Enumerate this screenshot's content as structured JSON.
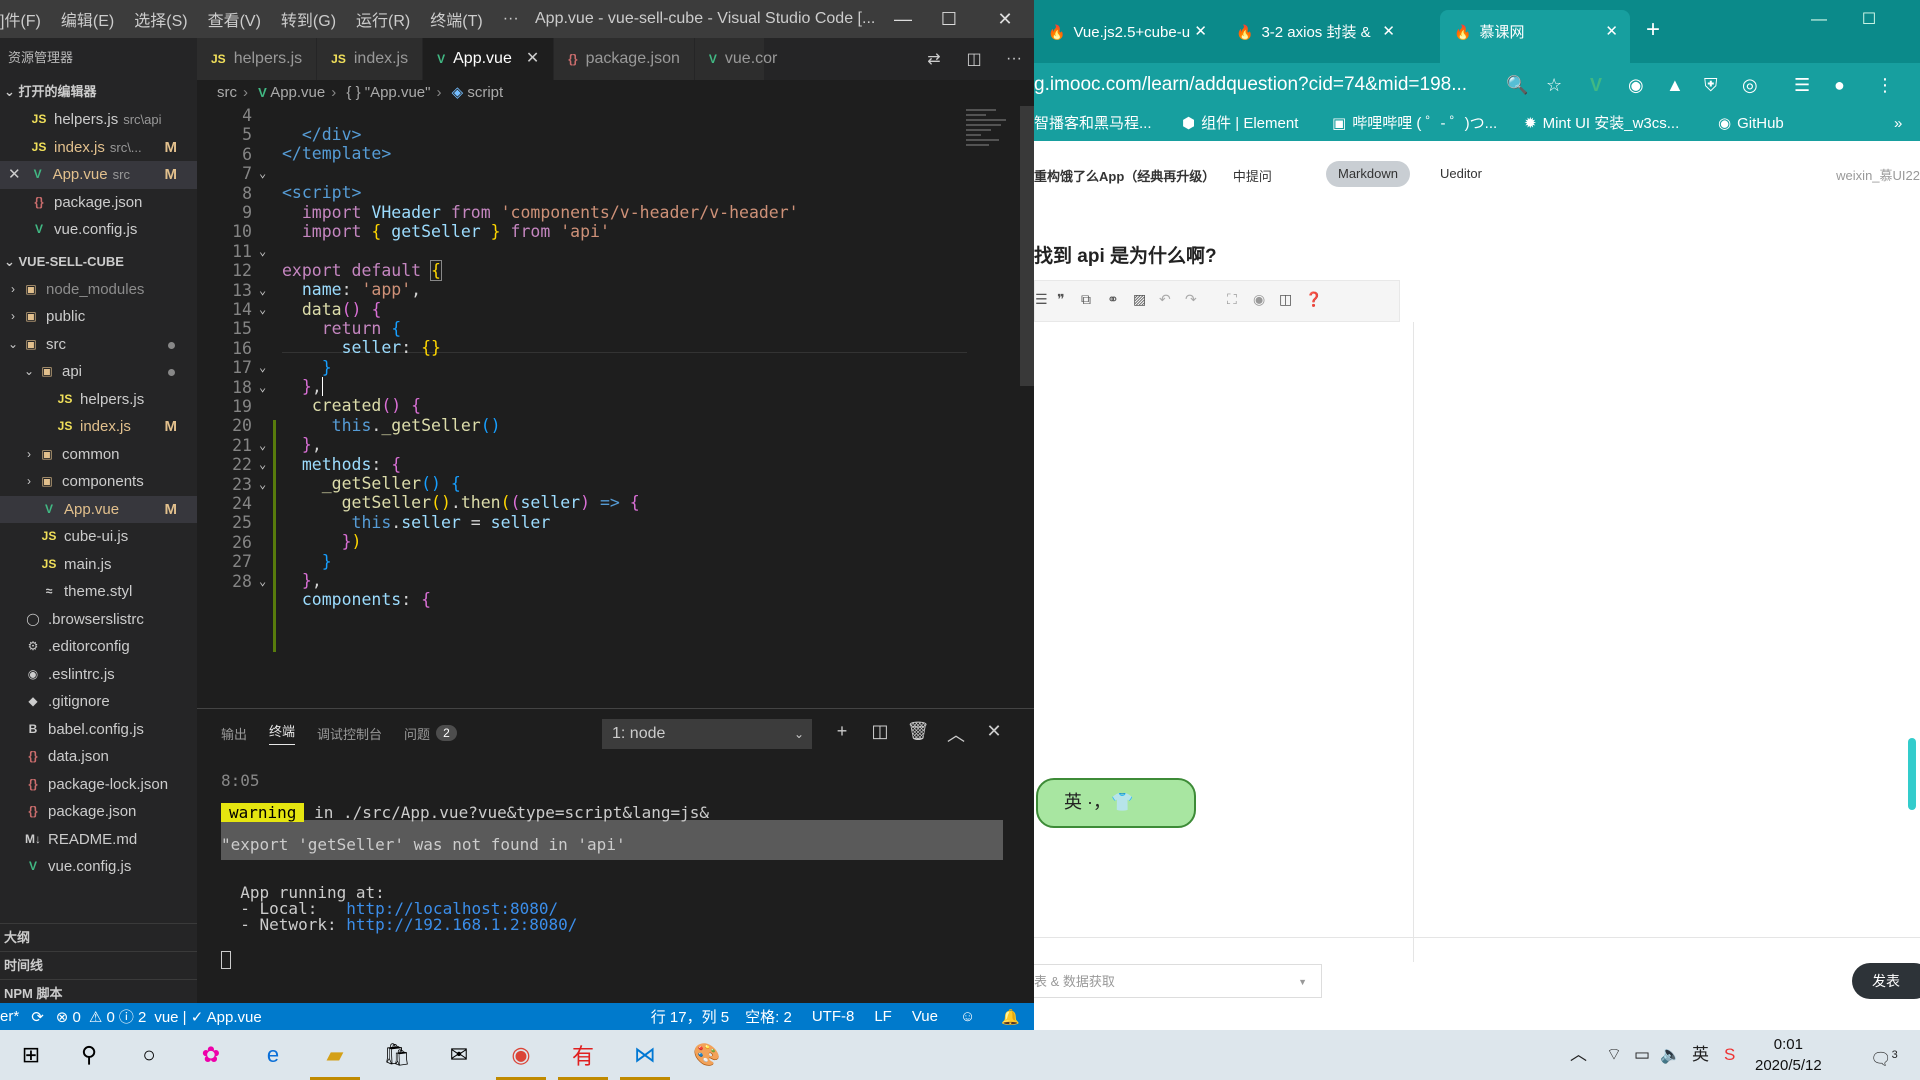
{
  "vscode": {
    "menu": [
      "]件(F)",
      "编辑(E)",
      "选择(S)",
      "查看(V)",
      "转到(G)",
      "运行(R)",
      "终端(T)",
      "···"
    ],
    "window_title": "App.vue - vue-sell-cube - Visual Studio Code [...",
    "window_controls": {
      "min": "—",
      "max": "☐",
      "close": "✕"
    },
    "explorer_title": "资源管理器",
    "open_editors_title": "打开的编辑器",
    "open_editors": [
      {
        "icon": "JS",
        "name": "helpers.js",
        "desc": "src\\api",
        "status": ""
      },
      {
        "icon": "JS",
        "name": "index.js",
        "desc": "src\\...",
        "status": "M"
      },
      {
        "icon": "V",
        "name": "App.vue",
        "desc": "src",
        "status": "M",
        "close": "✕"
      },
      {
        "icon": "{}",
        "name": "package.json",
        "desc": "",
        "status": ""
      },
      {
        "icon": "V",
        "name": "vue.config.js",
        "desc": "",
        "status": ""
      }
    ],
    "project_title": "VUE-SELL-CUBE",
    "tree": [
      {
        "arrow": "›",
        "icon": "▣",
        "name": "node_modules",
        "dim": true
      },
      {
        "arrow": "›",
        "icon": "▣",
        "name": "public"
      },
      {
        "arrow": "⌄",
        "icon": "▣",
        "name": "src",
        "dot": true
      },
      {
        "arrow": "⌄",
        "icon": "▣",
        "name": "api",
        "dot": true
      },
      {
        "icon": "JS",
        "name": "helpers.js"
      },
      {
        "icon": "JS",
        "name": "index.js",
        "status": "M"
      },
      {
        "arrow": "›",
        "icon": "▣",
        "name": "common"
      },
      {
        "arrow": "›",
        "icon": "▣",
        "name": "components"
      },
      {
        "icon": "V",
        "name": "App.vue",
        "status": "M"
      },
      {
        "icon": "JS",
        "name": "cube-ui.js"
      },
      {
        "icon": "JS",
        "name": "main.js"
      },
      {
        "icon": "≈",
        "name": "theme.styl"
      },
      {
        "icon": "◯",
        "name": ".browserslistrc"
      },
      {
        "icon": "⚙",
        "name": ".editorconfig"
      },
      {
        "icon": "◉",
        "name": ".eslintrc.js"
      },
      {
        "icon": "◆",
        "name": ".gitignore"
      },
      {
        "icon": "B",
        "name": "babel.config.js"
      },
      {
        "icon": "{}",
        "name": "data.json"
      },
      {
        "icon": "{}",
        "name": "package-lock.json"
      },
      {
        "icon": "{}",
        "name": "package.json"
      },
      {
        "icon": "M↓",
        "name": "README.md"
      },
      {
        "icon": "V",
        "name": "vue.config.js"
      }
    ],
    "outline_title": "大纲",
    "timeline_title": "时间线",
    "npm_title": "NPM 脚本",
    "tabs": [
      {
        "icon": "JS",
        "name": "helpers.js"
      },
      {
        "icon": "JS",
        "name": "index.js"
      },
      {
        "icon": "V",
        "name": "App.vue",
        "close": "✕"
      },
      {
        "icon": "{}",
        "name": "package.json"
      },
      {
        "icon": "V",
        "name": "vue.cor"
      }
    ],
    "breadcrumb": [
      "src",
      "App.vue",
      "{ } \"App.vue\"",
      "script"
    ],
    "line_numbers": [
      "4",
      "5",
      "6",
      "7",
      "8",
      "9",
      "10",
      "11",
      "12",
      "13",
      "14",
      "15",
      "16",
      "17",
      "18",
      "19",
      "20",
      "21",
      "22",
      "23",
      "24",
      "25",
      "26",
      "27",
      "28"
    ],
    "panel_tabs": [
      "输出",
      "终端",
      "调试控制台",
      "问题"
    ],
    "problems_count": "2",
    "terminal_select": "1: node",
    "terminal": {
      "time": "8:05",
      "warning_tag": "warning",
      "warning_msg": " in ./src/App.vue?vue&type=script&lang=js&",
      "error_msg": "\"export 'getSeller' was not found in 'api'",
      "running": "App running at:",
      "local_label": "- Local:   ",
      "local_url": "http://localhost:8080/",
      "network_label": "- Network: ",
      "network_url": "http://192.168.1.2:8080/"
    },
    "status": {
      "branch": "er*",
      "sync": "⟳",
      "errors": "⊗ 0",
      "warnings": "⚠ 0",
      "info": "ⓘ 2",
      "vue": "vue | ✓ App.vue",
      "position": "行 17，列 5",
      "spaces": "空格: 2",
      "encoding": "UTF-8",
      "eol": "LF",
      "lang": "Vue"
    }
  },
  "chrome": {
    "tabs": [
      {
        "title": "Vue.js2.5+cube-u"
      },
      {
        "title": "3-2 axios 封装 &"
      },
      {
        "title": "慕课网"
      }
    ],
    "url": "g.imooc.com/learn/addquestion?cid=74&mid=198...",
    "bookmarks": [
      "智播客和黑马程...",
      "组件 | Element",
      "哔哩哔哩 ( ゜- ゜)つ...",
      "Mint UI 安装_w3cs...",
      "GitHub"
    ],
    "bookmarks_more": "»",
    "page": {
      "course": "重构饿了么App（经典再升级）",
      "ask": "中提问",
      "mode_markdown": "Markdown",
      "mode_ueditor": "Ueditor",
      "user": "weixin_慕UI22",
      "question_title": "找到 api 是为什么啊?",
      "category": "表 & 数据获取",
      "publish": "发表"
    },
    "ime_text": "英 ·，👕"
  },
  "taskbar": {
    "time": "0:01",
    "date": "2020/5/12",
    "ime": "英",
    "notification_count": "3"
  }
}
